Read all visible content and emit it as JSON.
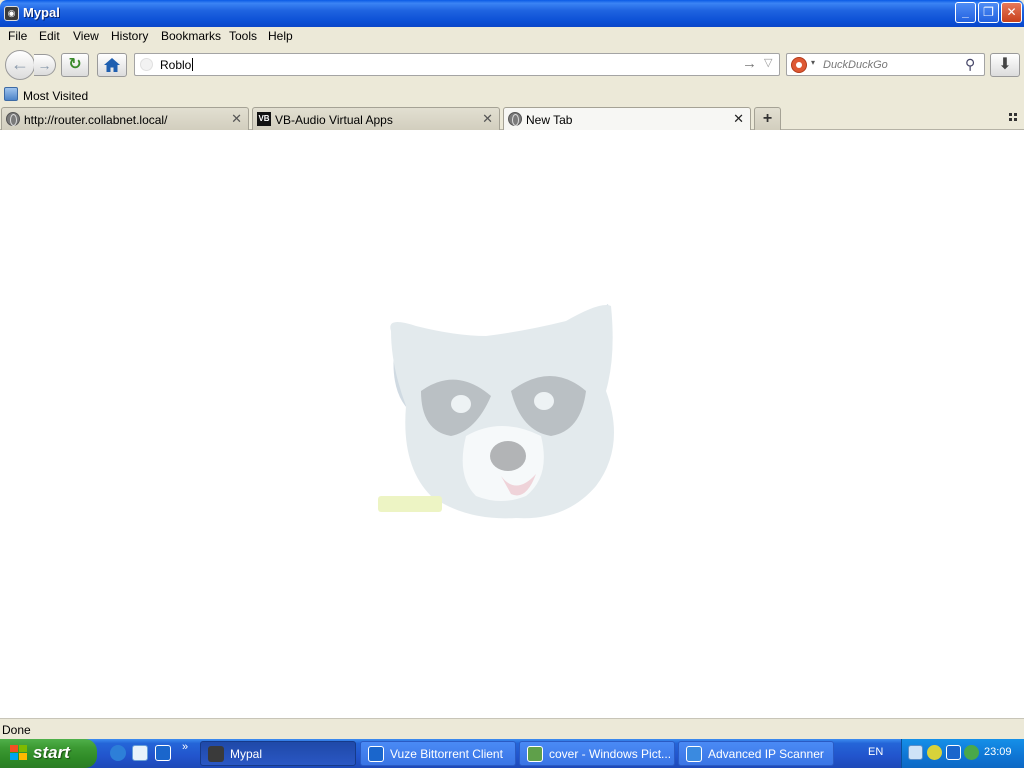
{
  "window": {
    "title": "Mypal",
    "minimize_label": "_",
    "maximize_label": "❐",
    "close_label": "✕"
  },
  "menu": {
    "items": [
      "File",
      "Edit",
      "View",
      "History",
      "Bookmarks",
      "Tools",
      "Help"
    ]
  },
  "navbar": {
    "url_value": "Roblo",
    "search_placeholder": "DuckDuckGo",
    "back_glyph": "←",
    "forward_glyph": "→",
    "reload_glyph": "↻",
    "go_glyph": "→",
    "url_dropdown_glyph": "▽",
    "search_engine_dropdown_glyph": "▾",
    "search_glyph": "⚲",
    "download_glyph": "⬇"
  },
  "bookmarks": {
    "most_visited": "Most Visited"
  },
  "tabs": [
    {
      "label": "http://router.collabnet.local/",
      "icon": "globe-icon",
      "active": false
    },
    {
      "label": "VB-Audio Virtual Apps",
      "icon": "vb-audio-icon",
      "active": false
    },
    {
      "label": "New Tab",
      "icon": "globe-icon",
      "active": true
    }
  ],
  "tab_close_glyph": "✕",
  "new_tab_glyph": "+",
  "status": {
    "text": "Done"
  },
  "taskbar": {
    "start_label": "start",
    "quicklaunch_more": "»",
    "tasks": [
      {
        "label": "Mypal",
        "active": true
      },
      {
        "label": "Vuze Bittorrent Client",
        "active": false
      },
      {
        "label": "cover - Windows Pict...",
        "active": false
      },
      {
        "label": "Advanced IP Scanner",
        "active": false
      }
    ],
    "language": "EN",
    "clock": "23:09"
  },
  "colors": {
    "titlebar_blue": "#0b4fd5",
    "start_green": "#3c9a33",
    "taskbar_blue": "#2254cc",
    "tray_blue": "#0e75d4"
  }
}
